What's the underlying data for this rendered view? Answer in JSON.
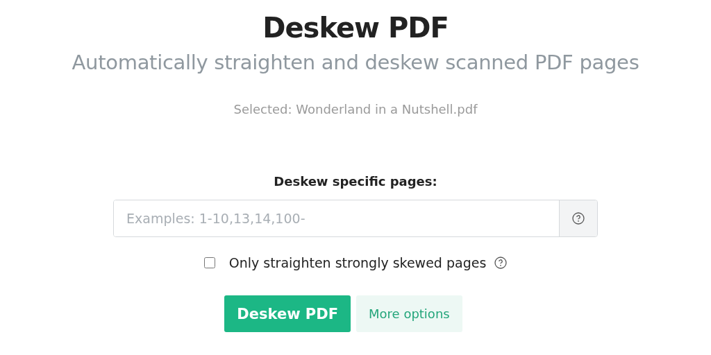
{
  "title": "Deskew PDF",
  "subtitle": "Automatically straighten and deskew scanned PDF pages",
  "selected_file": "Selected: Wonderland in a Nutshell.pdf",
  "pages_field": {
    "label": "Deskew specific pages:",
    "placeholder": "Examples: 1-10,13,14,100-"
  },
  "option": {
    "label": "Only straighten strongly skewed pages",
    "checked": false
  },
  "buttons": [
    {
      "label": "Deskew PDF",
      "kind": "primary"
    },
    {
      "label": "More options",
      "kind": "secondary"
    }
  ]
}
